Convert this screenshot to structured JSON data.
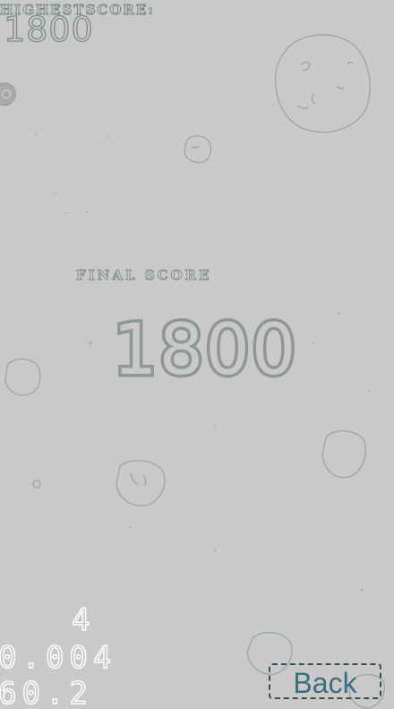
{
  "hud": {
    "highscore_label": "HIGHESTSCORE:",
    "highscore_value": "1800"
  },
  "game_over": {
    "final_score_label": "FINAL SCORE",
    "final_score_value": "1800"
  },
  "debug": {
    "line1": "4",
    "line2": "0.004",
    "line3": "60.2"
  },
  "back_button": {
    "label": "Back"
  },
  "colors": {
    "background": "#c9c9c9",
    "outline": "#8e9696",
    "back_text": "#3d6e7e"
  },
  "icons": {
    "side_button": "settings-circle-icon",
    "asteroids": "asteroid-outline-icon"
  }
}
